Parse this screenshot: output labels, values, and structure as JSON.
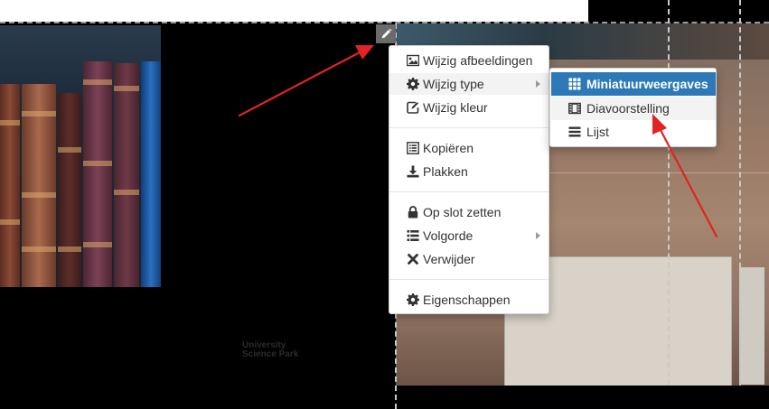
{
  "menu": {
    "items": [
      {
        "label": "Wijzig afbeeldingen",
        "icon": "image-icon"
      },
      {
        "label": "Wijzig type",
        "icon": "gear-icon",
        "has_submenu": true
      },
      {
        "label": "Wijzig kleur",
        "icon": "edit-square-icon"
      },
      {
        "label": "Kopiëren",
        "icon": "list-alt-icon"
      },
      {
        "label": "Plakken",
        "icon": "download-icon"
      },
      {
        "label": "Op slot zetten",
        "icon": "lock-icon"
      },
      {
        "label": "Volgorde",
        "icon": "list-icon",
        "has_submenu": true
      },
      {
        "label": "Verwijder",
        "icon": "close-icon"
      },
      {
        "label": "Eigenschappen",
        "icon": "gear-icon"
      }
    ]
  },
  "submenu": {
    "items": [
      {
        "label": "Miniatuurweergaves",
        "icon": "grid-icon",
        "state": "selected"
      },
      {
        "label": "Diavoorstelling",
        "icon": "film-icon",
        "state": "hover"
      },
      {
        "label": "Lijst",
        "icon": "bars-icon"
      }
    ]
  },
  "edit_button": {
    "icon": "pencil-icon"
  },
  "background": {
    "card_text_line1": "University",
    "card_text_line2": "Science Park"
  },
  "colors": {
    "accent": "#2d79b8",
    "annotation_arrow": "#e02424",
    "edit_button_bg": "#6b6b6b"
  }
}
